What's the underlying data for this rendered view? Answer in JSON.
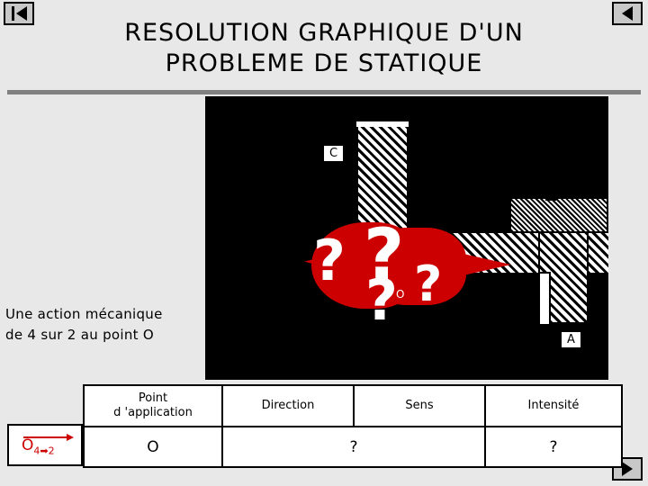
{
  "nav": {
    "first_label": "first-slide",
    "prev_label": "previous-slide",
    "next_label": "next-slide"
  },
  "title": {
    "line1": "RESOLUTION GRAPHIQUE D'UN",
    "line2": "PROBLEME DE STATIQUE"
  },
  "caption": {
    "line1": "Une action mécanique",
    "line2": "de 4 sur 2 au point O"
  },
  "picture": {
    "label_c": "C",
    "label_a": "A",
    "label_o": "O",
    "qmarks": [
      "?",
      "?",
      "?",
      "?"
    ]
  },
  "table": {
    "headers": [
      "Point\nd 'application",
      "Direction",
      "Sens",
      "Intensité"
    ],
    "header_point_line1": "Point",
    "header_point_line2": "d 'application",
    "header_direction": "Direction",
    "header_sens": "Sens",
    "header_intensite": "Intensité",
    "row": {
      "vector_label": "O",
      "vector_sub": "4",
      "vector_sub2": "2",
      "vector_arrow_sub": "4➡2",
      "point": "O",
      "direction": "?",
      "sens": "",
      "intensite": "?"
    }
  },
  "colors": {
    "red": "#cc0000",
    "background": "#e8e8e8",
    "rule": "#808080",
    "picture_bg": "#000000"
  }
}
